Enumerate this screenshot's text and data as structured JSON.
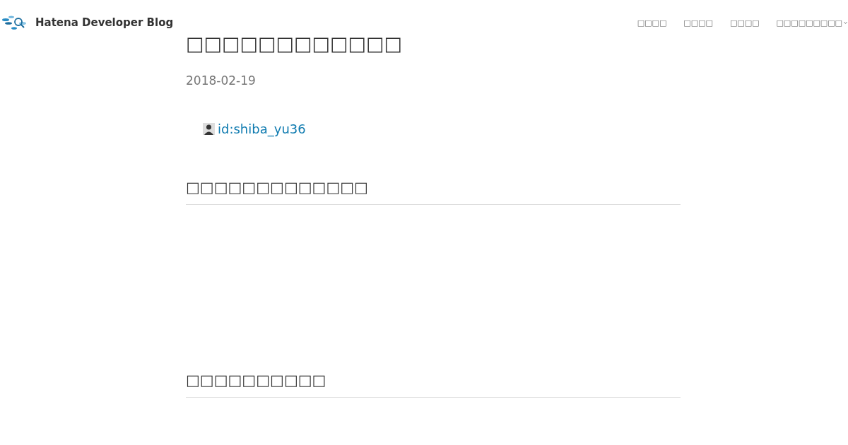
{
  "header": {
    "blog_title": "Hatena Developer Blog",
    "nav": [
      {
        "label": "□□□□"
      },
      {
        "label": "□□□□"
      },
      {
        "label": "□□□□"
      },
      {
        "label": "□□□□□□□□□"
      }
    ]
  },
  "article": {
    "title": "□□□□□□□□□□□□",
    "date": "2018-02-19",
    "author": "id:shiba_yu36",
    "sections": [
      {
        "heading": "□□□□□□□□□□□□□"
      },
      {
        "heading": "□□□□□□□□□□"
      }
    ]
  }
}
